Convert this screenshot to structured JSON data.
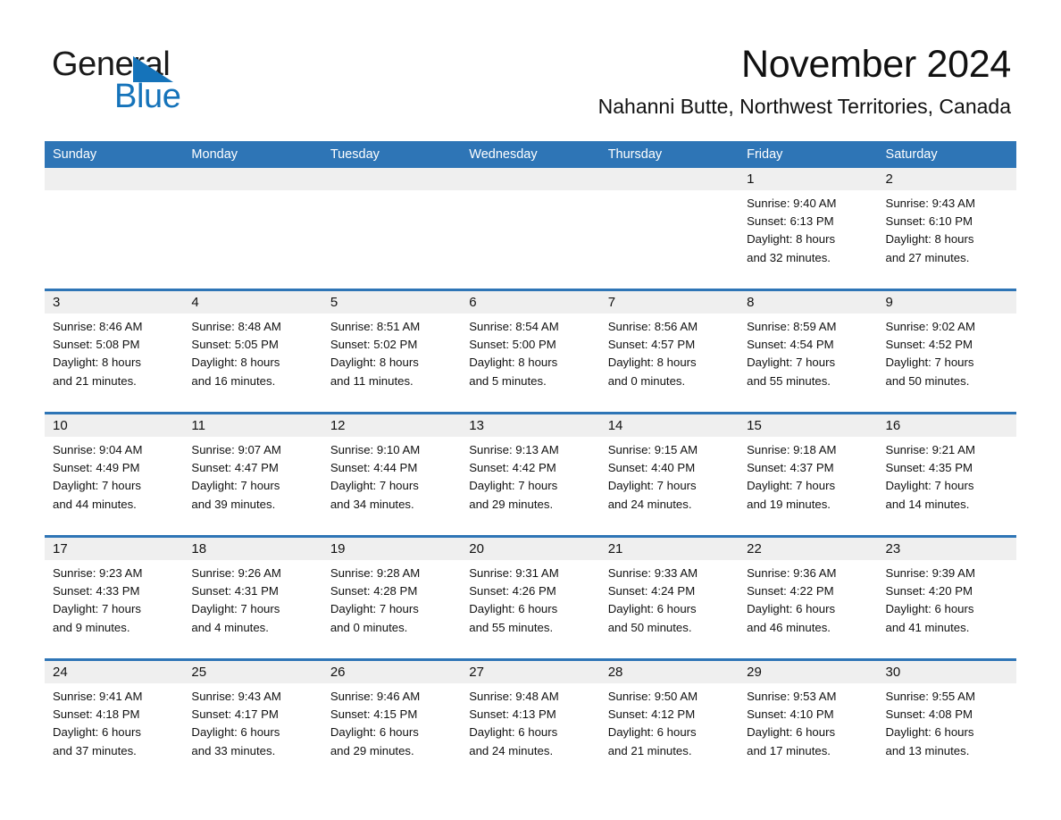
{
  "brand": {
    "word_one": "General",
    "word_two": "Blue",
    "logo_icon": "triangle-icon",
    "accent_color": "#1573ba"
  },
  "header": {
    "month_title": "November 2024",
    "location": "Nahanni Butte, Northwest Territories, Canada"
  },
  "theme": {
    "header_blue": "#2e75b6",
    "date_band_gray": "#efefef",
    "text_color": "#111111"
  },
  "weekdays": [
    "Sunday",
    "Monday",
    "Tuesday",
    "Wednesday",
    "Thursday",
    "Friday",
    "Saturday"
  ],
  "weeks": [
    {
      "days": [
        {
          "date": "",
          "lines": []
        },
        {
          "date": "",
          "lines": []
        },
        {
          "date": "",
          "lines": []
        },
        {
          "date": "",
          "lines": []
        },
        {
          "date": "",
          "lines": []
        },
        {
          "date": "1",
          "lines": [
            "Sunrise: 9:40 AM",
            "Sunset: 6:13 PM",
            "Daylight: 8 hours",
            "and 32 minutes."
          ]
        },
        {
          "date": "2",
          "lines": [
            "Sunrise: 9:43 AM",
            "Sunset: 6:10 PM",
            "Daylight: 8 hours",
            "and 27 minutes."
          ]
        }
      ]
    },
    {
      "days": [
        {
          "date": "3",
          "lines": [
            "Sunrise: 8:46 AM",
            "Sunset: 5:08 PM",
            "Daylight: 8 hours",
            "and 21 minutes."
          ]
        },
        {
          "date": "4",
          "lines": [
            "Sunrise: 8:48 AM",
            "Sunset: 5:05 PM",
            "Daylight: 8 hours",
            "and 16 minutes."
          ]
        },
        {
          "date": "5",
          "lines": [
            "Sunrise: 8:51 AM",
            "Sunset: 5:02 PM",
            "Daylight: 8 hours",
            "and 11 minutes."
          ]
        },
        {
          "date": "6",
          "lines": [
            "Sunrise: 8:54 AM",
            "Sunset: 5:00 PM",
            "Daylight: 8 hours",
            "and 5 minutes."
          ]
        },
        {
          "date": "7",
          "lines": [
            "Sunrise: 8:56 AM",
            "Sunset: 4:57 PM",
            "Daylight: 8 hours",
            "and 0 minutes."
          ]
        },
        {
          "date": "8",
          "lines": [
            "Sunrise: 8:59 AM",
            "Sunset: 4:54 PM",
            "Daylight: 7 hours",
            "and 55 minutes."
          ]
        },
        {
          "date": "9",
          "lines": [
            "Sunrise: 9:02 AM",
            "Sunset: 4:52 PM",
            "Daylight: 7 hours",
            "and 50 minutes."
          ]
        }
      ]
    },
    {
      "days": [
        {
          "date": "10",
          "lines": [
            "Sunrise: 9:04 AM",
            "Sunset: 4:49 PM",
            "Daylight: 7 hours",
            "and 44 minutes."
          ]
        },
        {
          "date": "11",
          "lines": [
            "Sunrise: 9:07 AM",
            "Sunset: 4:47 PM",
            "Daylight: 7 hours",
            "and 39 minutes."
          ]
        },
        {
          "date": "12",
          "lines": [
            "Sunrise: 9:10 AM",
            "Sunset: 4:44 PM",
            "Daylight: 7 hours",
            "and 34 minutes."
          ]
        },
        {
          "date": "13",
          "lines": [
            "Sunrise: 9:13 AM",
            "Sunset: 4:42 PM",
            "Daylight: 7 hours",
            "and 29 minutes."
          ]
        },
        {
          "date": "14",
          "lines": [
            "Sunrise: 9:15 AM",
            "Sunset: 4:40 PM",
            "Daylight: 7 hours",
            "and 24 minutes."
          ]
        },
        {
          "date": "15",
          "lines": [
            "Sunrise: 9:18 AM",
            "Sunset: 4:37 PM",
            "Daylight: 7 hours",
            "and 19 minutes."
          ]
        },
        {
          "date": "16",
          "lines": [
            "Sunrise: 9:21 AM",
            "Sunset: 4:35 PM",
            "Daylight: 7 hours",
            "and 14 minutes."
          ]
        }
      ]
    },
    {
      "days": [
        {
          "date": "17",
          "lines": [
            "Sunrise: 9:23 AM",
            "Sunset: 4:33 PM",
            "Daylight: 7 hours",
            "and 9 minutes."
          ]
        },
        {
          "date": "18",
          "lines": [
            "Sunrise: 9:26 AM",
            "Sunset: 4:31 PM",
            "Daylight: 7 hours",
            "and 4 minutes."
          ]
        },
        {
          "date": "19",
          "lines": [
            "Sunrise: 9:28 AM",
            "Sunset: 4:28 PM",
            "Daylight: 7 hours",
            "and 0 minutes."
          ]
        },
        {
          "date": "20",
          "lines": [
            "Sunrise: 9:31 AM",
            "Sunset: 4:26 PM",
            "Daylight: 6 hours",
            "and 55 minutes."
          ]
        },
        {
          "date": "21",
          "lines": [
            "Sunrise: 9:33 AM",
            "Sunset: 4:24 PM",
            "Daylight: 6 hours",
            "and 50 minutes."
          ]
        },
        {
          "date": "22",
          "lines": [
            "Sunrise: 9:36 AM",
            "Sunset: 4:22 PM",
            "Daylight: 6 hours",
            "and 46 minutes."
          ]
        },
        {
          "date": "23",
          "lines": [
            "Sunrise: 9:39 AM",
            "Sunset: 4:20 PM",
            "Daylight: 6 hours",
            "and 41 minutes."
          ]
        }
      ]
    },
    {
      "days": [
        {
          "date": "24",
          "lines": [
            "Sunrise: 9:41 AM",
            "Sunset: 4:18 PM",
            "Daylight: 6 hours",
            "and 37 minutes."
          ]
        },
        {
          "date": "25",
          "lines": [
            "Sunrise: 9:43 AM",
            "Sunset: 4:17 PM",
            "Daylight: 6 hours",
            "and 33 minutes."
          ]
        },
        {
          "date": "26",
          "lines": [
            "Sunrise: 9:46 AM",
            "Sunset: 4:15 PM",
            "Daylight: 6 hours",
            "and 29 minutes."
          ]
        },
        {
          "date": "27",
          "lines": [
            "Sunrise: 9:48 AM",
            "Sunset: 4:13 PM",
            "Daylight: 6 hours",
            "and 24 minutes."
          ]
        },
        {
          "date": "28",
          "lines": [
            "Sunrise: 9:50 AM",
            "Sunset: 4:12 PM",
            "Daylight: 6 hours",
            "and 21 minutes."
          ]
        },
        {
          "date": "29",
          "lines": [
            "Sunrise: 9:53 AM",
            "Sunset: 4:10 PM",
            "Daylight: 6 hours",
            "and 17 minutes."
          ]
        },
        {
          "date": "30",
          "lines": [
            "Sunrise: 9:55 AM",
            "Sunset: 4:08 PM",
            "Daylight: 6 hours",
            "and 13 minutes."
          ]
        }
      ]
    }
  ]
}
